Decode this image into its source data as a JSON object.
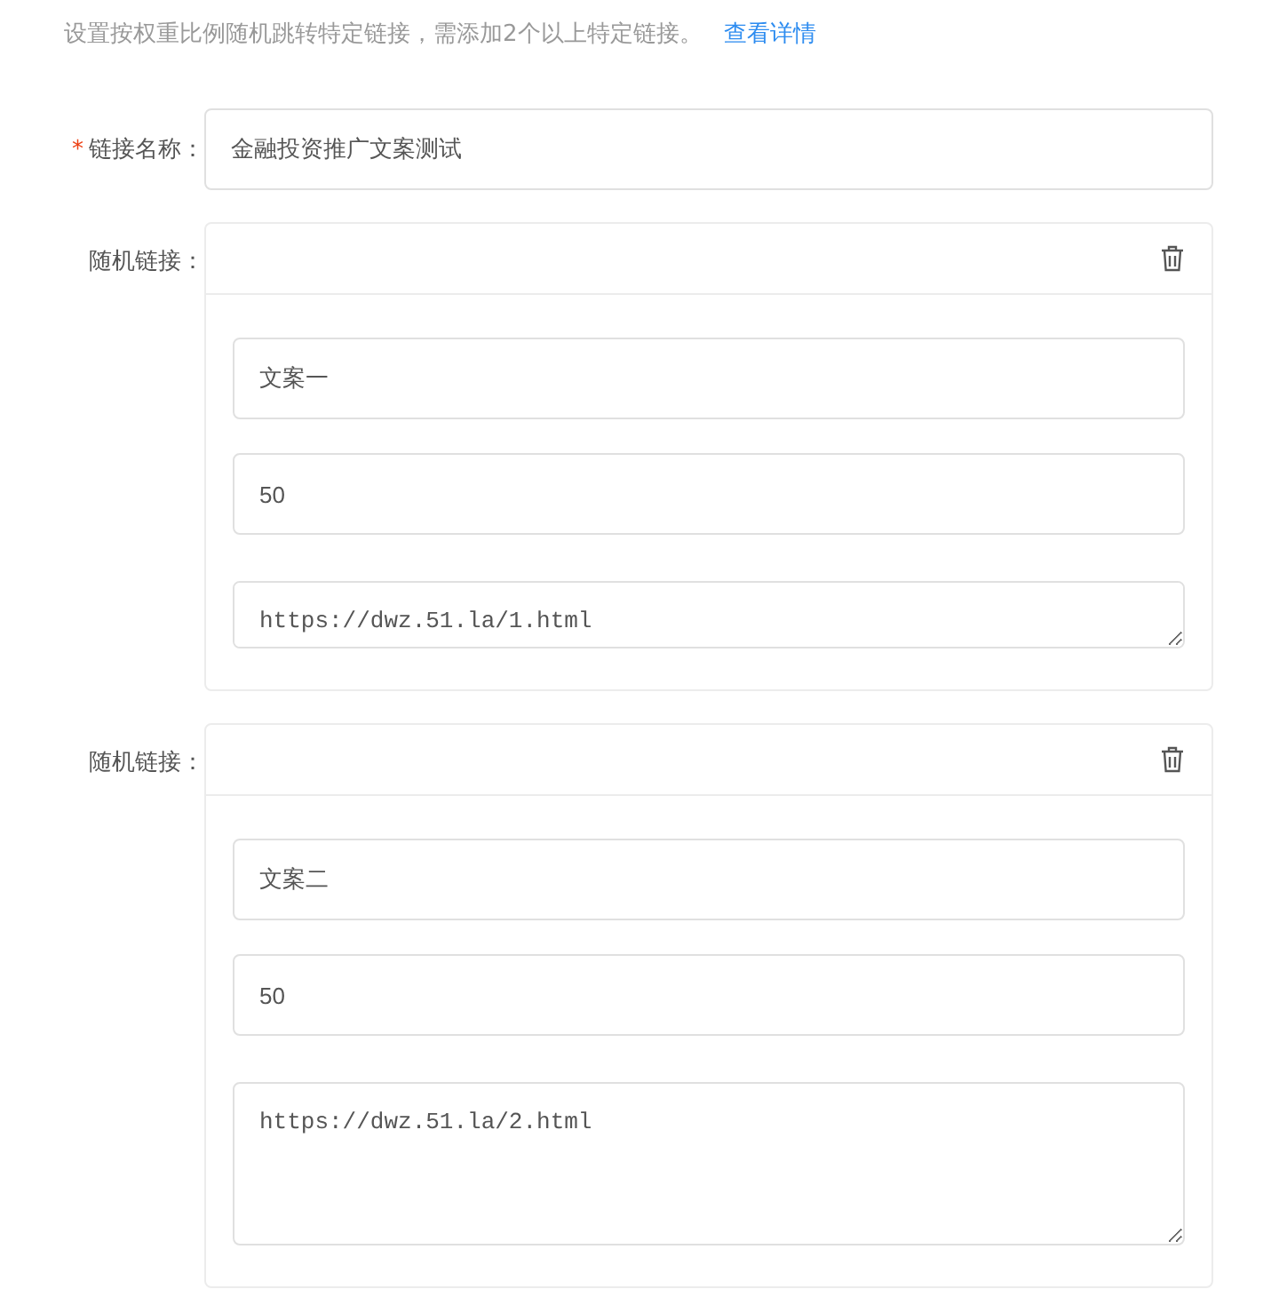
{
  "note": {
    "text": "设置按权重比例随机跳转特定链接，需添加2个以上特定链接。",
    "link": "查看详情"
  },
  "name_field": {
    "label": "链接名称：",
    "required": true,
    "required_mark": "*",
    "value": "金融投资推广文案测试"
  },
  "random_links": [
    {
      "label": "随机链接：",
      "title": "文案一",
      "weight": "50",
      "url": "https://dwz.51.la/1.html"
    },
    {
      "label": "随机链接：",
      "title": "文案二",
      "weight": "50",
      "url": "https://dwz.51.la/2.html"
    }
  ]
}
